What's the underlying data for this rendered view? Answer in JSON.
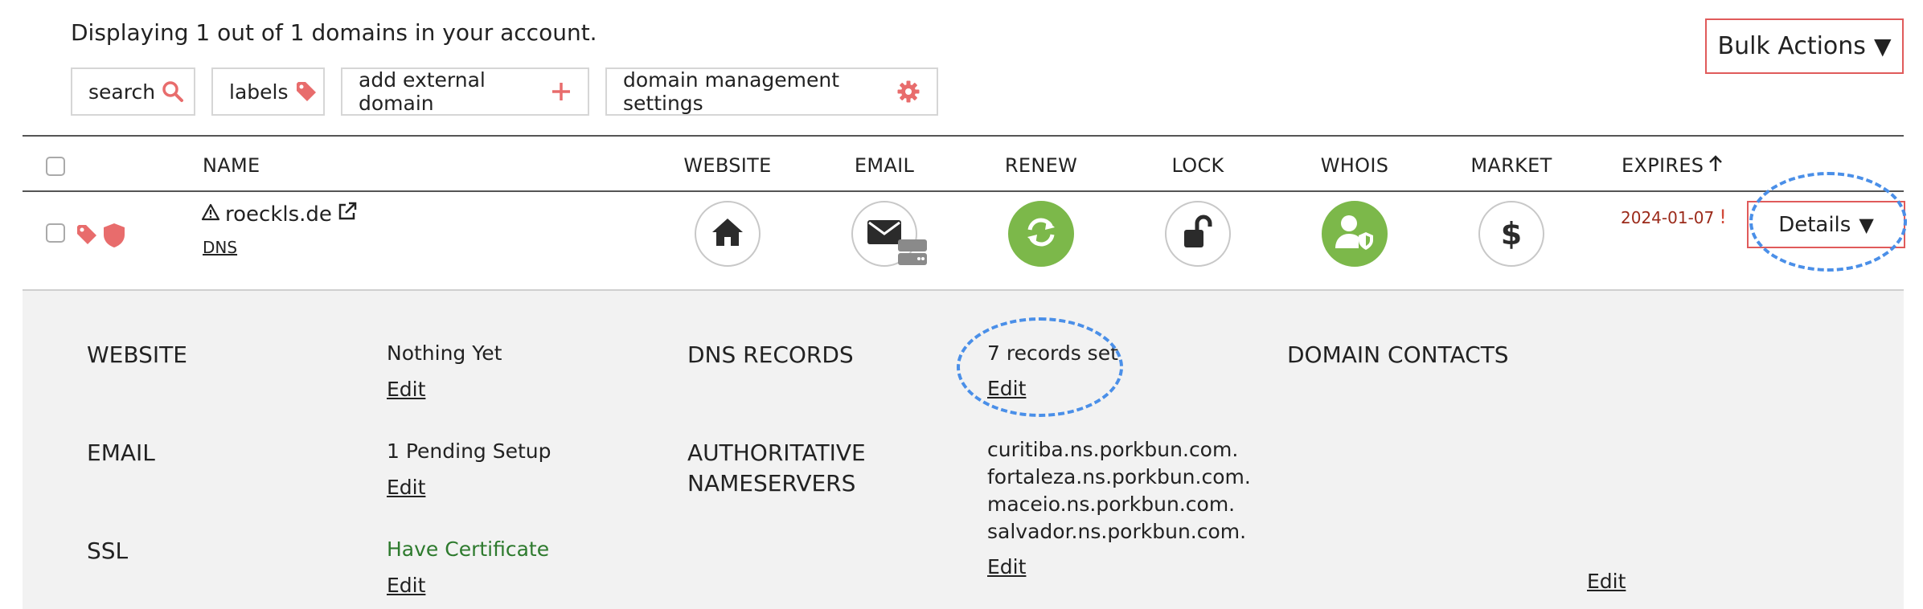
{
  "summary": "Displaying 1 out of 1 domains in your account.",
  "toolbar": {
    "search": "search",
    "labels": "labels",
    "add_external": "add external domain",
    "settings": "domain management settings",
    "bulk_actions": "Bulk Actions"
  },
  "table": {
    "headers": {
      "name": "NAME",
      "website": "WEBSITE",
      "email": "EMAIL",
      "renew": "RENEW",
      "lock": "LOCK",
      "whois": "WHOIS",
      "market": "MARKET",
      "expires": "EXPIRES"
    }
  },
  "domain": {
    "name": "roeckls.de",
    "dns_link": "DNS",
    "expires": "2024-01-07",
    "expires_flag": "!",
    "details_label": "Details",
    "icons": {
      "website": "home-icon",
      "email": "envelope-icon",
      "renew": "refresh-icon",
      "lock": "unlock-icon",
      "whois": "user-shield-icon",
      "market": "dollar-icon"
    }
  },
  "details": {
    "website_label": "WEBSITE",
    "website_value": "Nothing Yet",
    "email_label": "EMAIL",
    "email_value": "1 Pending Setup",
    "ssl_label": "SSL",
    "ssl_value": "Have Certificate",
    "dns_records_label": "DNS RECORDS",
    "dns_records_value": "7 records set",
    "auth_ns_label_line1": "AUTHORITATIVE",
    "auth_ns_label_line2": "NAMESERVERS",
    "nameservers": [
      "curitiba.ns.porkbun.com.",
      "fortaleza.ns.porkbun.com.",
      "maceio.ns.porkbun.com.",
      "salvador.ns.porkbun.com."
    ],
    "contacts_label": "DOMAIN CONTACTS",
    "edit_label": "Edit"
  },
  "colors": {
    "accent_red": "#e05b5b",
    "green": "#7cb84a",
    "highlight_blue": "#4a8fe8",
    "expires_red": "#9b2a1a"
  }
}
